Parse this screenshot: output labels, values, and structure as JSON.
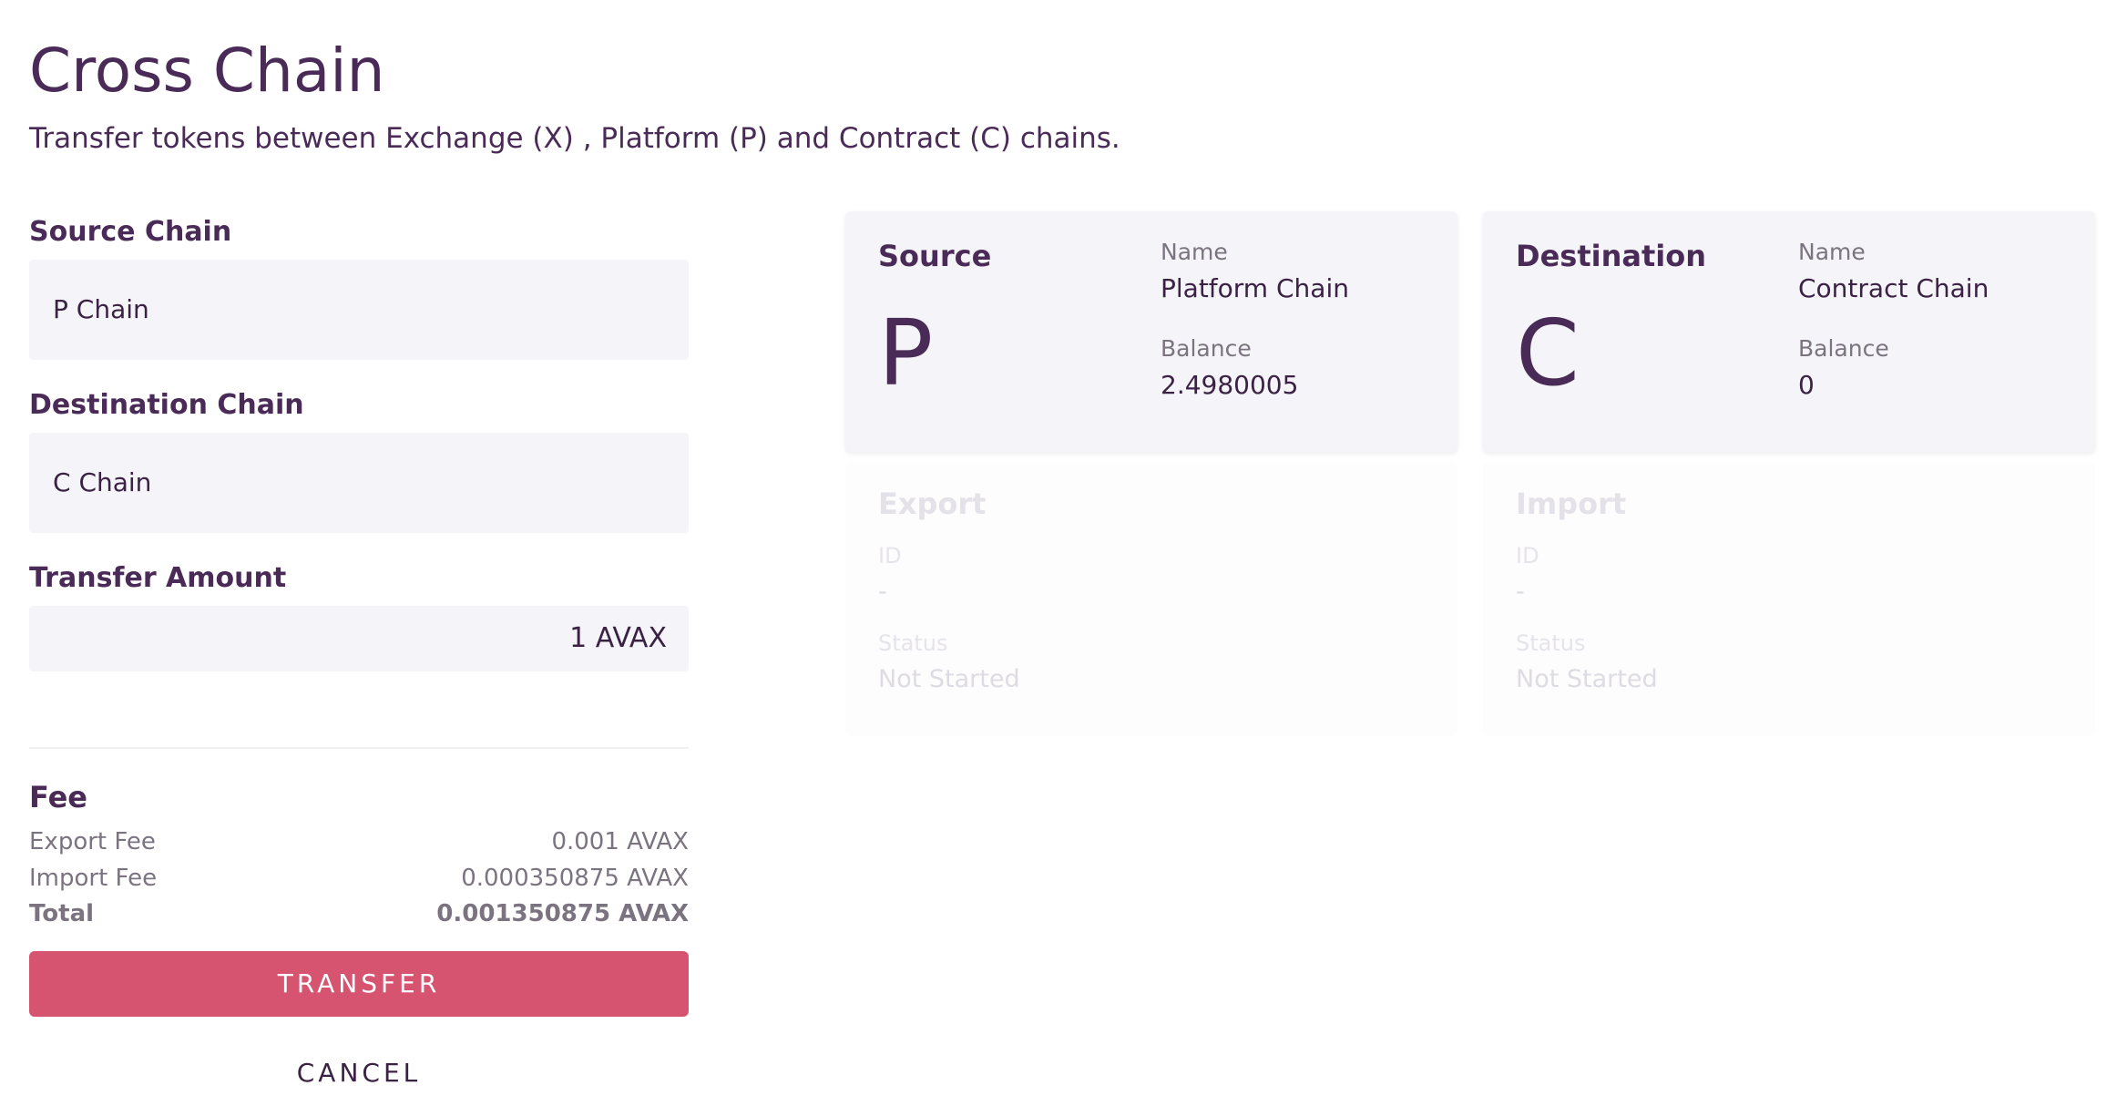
{
  "header": {
    "title": "Cross Chain",
    "subtitle": "Transfer tokens between Exchange (X) , Platform (P) and Contract (C) chains."
  },
  "form": {
    "source_label": "Source Chain",
    "source_value": "P Chain",
    "destination_label": "Destination Chain",
    "destination_value": "C Chain",
    "amount_label": "Transfer Amount",
    "amount_value": "1 AVAX"
  },
  "fee": {
    "title": "Fee",
    "export_label": "Export Fee",
    "export_value": "0.001 AVAX",
    "import_label": "Import Fee",
    "import_value": "0.000350875 AVAX",
    "total_label": "Total",
    "total_value": "0.001350875 AVAX"
  },
  "actions": {
    "transfer_label": "TRANSFER",
    "cancel_label": "CANCEL"
  },
  "source_card": {
    "title": "Source",
    "letter": "P",
    "name_label": "Name",
    "name_value": "Platform Chain",
    "balance_label": "Balance",
    "balance_value": "2.4980005"
  },
  "destination_card": {
    "title": "Destination",
    "letter": "C",
    "name_label": "Name",
    "name_value": "Contract Chain",
    "balance_label": "Balance",
    "balance_value": "0"
  },
  "export_card": {
    "title": "Export",
    "id_label": "ID",
    "id_value": "-",
    "status_label": "Status",
    "status_value": "Not Started"
  },
  "import_card": {
    "title": "Import",
    "id_label": "ID",
    "id_value": "-",
    "status_label": "Status",
    "status_value": "Not Started"
  },
  "colors": {
    "primary_text": "#4a2b57",
    "accent_button": "#d6546f",
    "field_background": "#f5f5f9"
  }
}
